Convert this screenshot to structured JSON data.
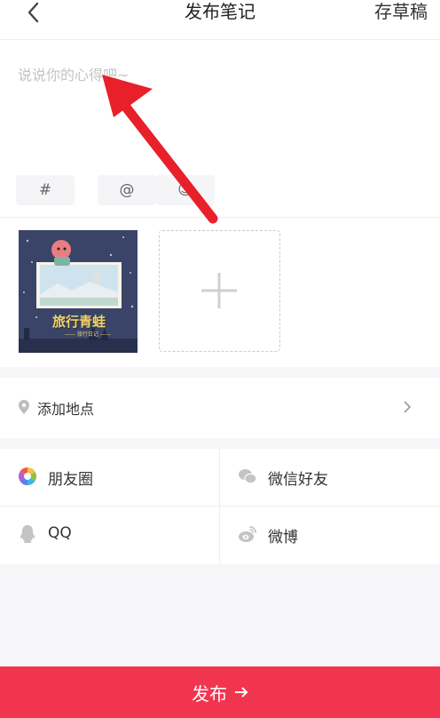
{
  "header": {
    "title": "发布笔记",
    "save_draft_label": "存草稿"
  },
  "editor": {
    "placeholder": "说说你的心得吧~",
    "value": "",
    "chips": [
      {
        "icon": "hashtag-icon",
        "glyph": "#"
      },
      {
        "icon": "mention-icon",
        "glyph": "@"
      },
      {
        "icon": "emoji-icon",
        "glyph": "☺"
      }
    ]
  },
  "images": {
    "thumbnail_text": "旅行青蛙",
    "thumbnail_subtext": "—— 旅行日记 ——"
  },
  "location": {
    "label": "添加地点"
  },
  "share": [
    {
      "icon": "moments-icon",
      "label": "朋友圈"
    },
    {
      "icon": "wechat-icon",
      "label": "微信好友"
    },
    {
      "icon": "qq-icon",
      "label": "QQ"
    },
    {
      "icon": "weibo-icon",
      "label": "微博"
    }
  ],
  "publish": {
    "label": "发布",
    "color": "#f2354f"
  }
}
